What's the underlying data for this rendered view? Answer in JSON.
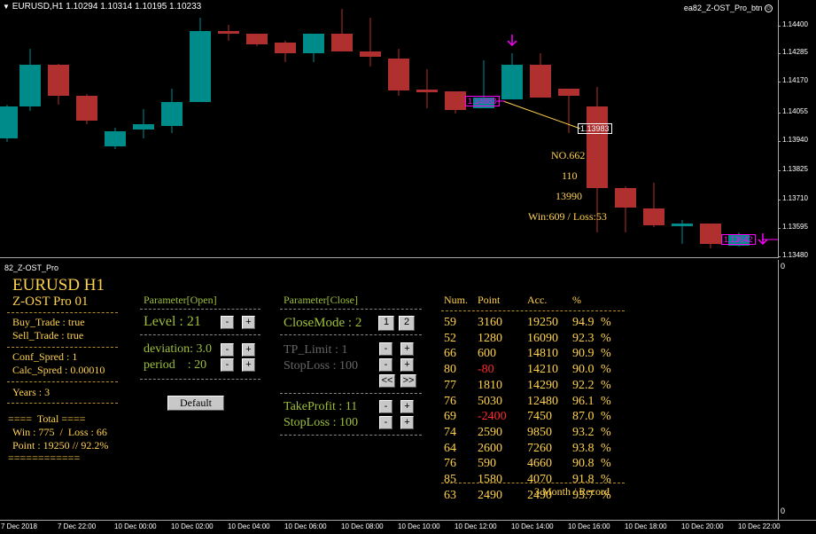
{
  "chart": {
    "header": "EURUSD,H1  1.10294 1.10314 1.10195 1.10233",
    "ea_label": "ea82_Z-OST_Pro_btn",
    "price_ticks": [
      "1.14400",
      "1.14285",
      "1.14170",
      "1.14055",
      "1.13940",
      "1.13825",
      "1.13710",
      "1.13595",
      "1.13480"
    ],
    "price_labels": [
      "1.14083",
      "1.13983",
      "1.13642"
    ],
    "info_lines": [
      "NO.662",
      "110",
      "13990",
      "Win:609 / Loss:53"
    ],
    "up_color": "#008b8b",
    "down_color": "#b03030"
  },
  "subwindow": {
    "title": "82_Z-OST_Pro",
    "axis_top": "0",
    "axis_bottom": "0",
    "symbol": "EURUSD H1",
    "ea_name": "Z-OST Pro 01",
    "buy_trade": "Buy_Trade : true",
    "sell_trade": "Sell_Trade : true",
    "conf_spred": "Conf_Spred : 1",
    "calc_spred": "Calc_Spred : 0.00010",
    "years": "Years : 3",
    "total_header": "====  Total ====",
    "total_win_loss": "Win : 775  /  Loss : 66",
    "total_point": "Point : 19250 // 92.2%",
    "total_footer": "============",
    "param_open_title": "Parameter[Open]",
    "level": "Level : 21",
    "deviation": "deviation: 3.0",
    "period": "period    : 20",
    "default_btn": "Default",
    "param_close_title": "Parameter[Close]",
    "close_mode": "CloseMode : 2",
    "tp_limit": "TP_Limit : 1",
    "stop_loss_1": "StopLoss : 100",
    "take_profit": "TakeProfit : 11",
    "stop_loss_2": "StopLoss : 100",
    "btn_minus": "-",
    "btn_plus": "+",
    "btn_mode1": "1",
    "btn_mode2": "2",
    "btn_prev": "<<",
    "btn_next": ">>",
    "record_headers": [
      "Num.",
      "Point",
      "Acc.",
      "%"
    ],
    "records": [
      {
        "num": "59",
        "point": "3160",
        "acc": "19250",
        "pct": "94.9",
        "unit": "%",
        "neg": false
      },
      {
        "num": "52",
        "point": "1280",
        "acc": "16090",
        "pct": "92.3",
        "unit": "%",
        "neg": false
      },
      {
        "num": "66",
        "point": "600",
        "acc": "14810",
        "pct": "90.9",
        "unit": "%",
        "neg": false
      },
      {
        "num": "80",
        "point": "-80",
        "acc": "14210",
        "pct": "90.0",
        "unit": "%",
        "neg": true
      },
      {
        "num": "77",
        "point": "1810",
        "acc": "14290",
        "pct": "92.2",
        "unit": "%",
        "neg": false
      },
      {
        "num": "76",
        "point": "5030",
        "acc": "12480",
        "pct": "96.1",
        "unit": "%",
        "neg": false
      },
      {
        "num": "69",
        "point": "-2400",
        "acc": "7450",
        "pct": "87.0",
        "unit": "%",
        "neg": true
      },
      {
        "num": "74",
        "point": "2590",
        "acc": "9850",
        "pct": "93.2",
        "unit": "%",
        "neg": false
      },
      {
        "num": "64",
        "point": "2600",
        "acc": "7260",
        "pct": "93.8",
        "unit": "%",
        "neg": false
      },
      {
        "num": "76",
        "point": "590",
        "acc": "4660",
        "pct": "90.8",
        "unit": "%",
        "neg": false
      },
      {
        "num": "85",
        "point": "1580",
        "acc": "4070",
        "pct": "91.8",
        "unit": "%",
        "neg": false
      },
      {
        "num": "63",
        "point": "2490",
        "acc": "2490",
        "pct": "93.7",
        "unit": "%",
        "neg": false
      }
    ],
    "record_footer": "3 Month / Record"
  },
  "time_axis": [
    "7 Dec 2018",
    "7 Dec 22:00",
    "10 Dec 00:00",
    "10 Dec 02:00",
    "10 Dec 04:00",
    "10 Dec 06:00",
    "10 Dec 08:00",
    "10 Dec 10:00",
    "10 Dec 12:00",
    "10 Dec 14:00",
    "10 Dec 16:00",
    "10 Dec 18:00",
    "10 Dec 20:00",
    "10 Dec 22:00"
  ]
}
